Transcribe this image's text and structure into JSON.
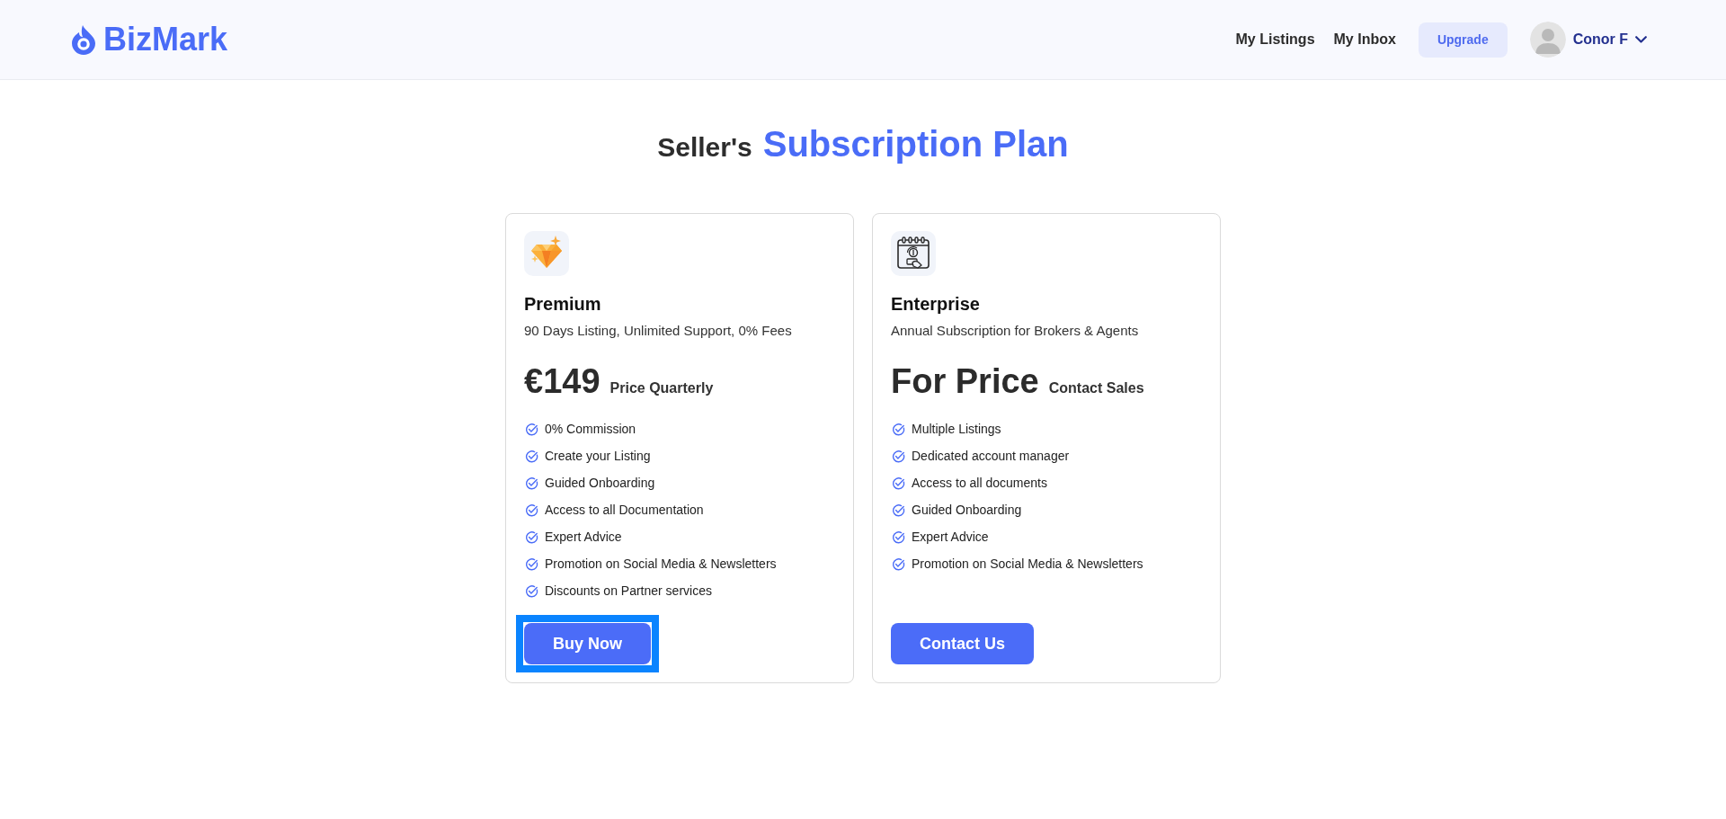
{
  "header": {
    "logo": "BizMark",
    "nav_links": [
      {
        "label": "My Listings"
      },
      {
        "label": "My Inbox"
      }
    ],
    "upgrade_button": {
      "label": "Upgrade"
    },
    "user": {
      "name": "Conor F"
    }
  },
  "page_title": {
    "lead": "Seller's",
    "highlight": "Subscription Plan"
  },
  "plans": [
    {
      "kind": "premium",
      "name": "Premium",
      "description": "90 Days Listing, Unlimited Support, 0% Fees",
      "price": "€149",
      "price_note": "Price Quarterly",
      "features": [
        "0% Commission",
        "Create your Listing",
        "Guided Onboarding",
        "Access to all Documentation",
        "Expert Advice",
        "Promotion on Social Media & Newsletters",
        "Discounts on Partner services"
      ],
      "button": {
        "label": "Buy Now",
        "focused": true
      }
    },
    {
      "kind": "enterprise",
      "name": "Enterprise",
      "description": "Annual Subscription for Brokers & Agents",
      "price": "For Price",
      "price_note": "Contact Sales",
      "features": [
        "Multiple Listings",
        "Dedicated account manager",
        "Access to all documents",
        "Guided Onboarding",
        "Expert Advice",
        "Promotion on Social Media & Newsletters"
      ],
      "button": {
        "label": "Contact Us",
        "focused": false
      }
    }
  ]
}
